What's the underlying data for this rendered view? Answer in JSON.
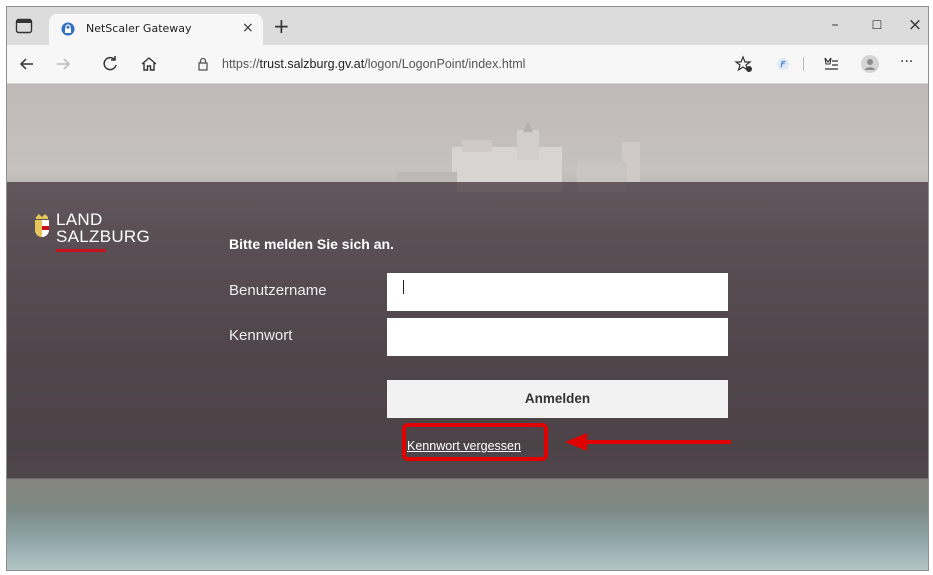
{
  "browser": {
    "tab_title": "NetScaler Gateway",
    "tab_close": "×",
    "new_tab": "+",
    "url_prefix": "https://",
    "url_host": "trust.salzburg.gv.at",
    "url_path": "/logon/LogonPoint/index.html",
    "minimize": "–",
    "maximize": "☐",
    "close": "×",
    "more": "···"
  },
  "logo": {
    "line1": "LAND",
    "line2": "SALZBURG"
  },
  "form": {
    "heading": "Bitte melden Sie sich an.",
    "username_label": "Benutzername",
    "password_label": "Kennwort",
    "username_value": "",
    "password_value": "",
    "submit_label": "Anmelden",
    "forgot_link": "Kennwort vergessen"
  },
  "annotation": {
    "highlight_color": "#e00000"
  }
}
